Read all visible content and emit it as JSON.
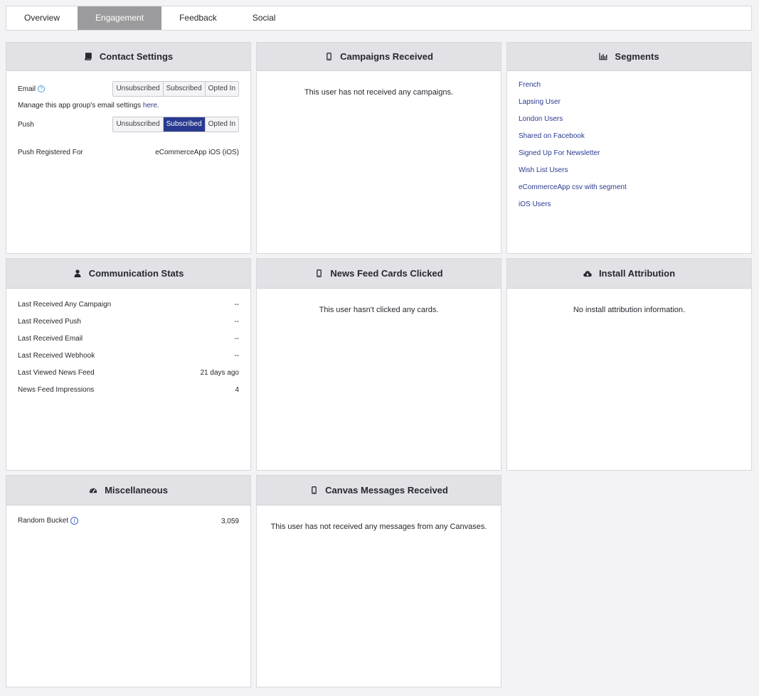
{
  "tabs": [
    {
      "label": "Overview"
    },
    {
      "label": "Engagement"
    },
    {
      "label": "Feedback"
    },
    {
      "label": "Social"
    }
  ],
  "contact": {
    "title": "Contact Settings",
    "email_label": "Email",
    "help_glyph": "?",
    "options": [
      "Unsubscribed",
      "Subscribed",
      "Opted In"
    ],
    "manage_text": "Manage this app group's email settings ",
    "manage_link": "here",
    "manage_end": ".",
    "push_label": "Push",
    "push_registered_label": "Push Registered For",
    "push_registered_value": "eCommerceApp iOS (iOS)"
  },
  "campaigns": {
    "title": "Campaigns Received",
    "empty": "This user has not received any campaigns."
  },
  "segments": {
    "title": "Segments",
    "items": [
      "French",
      "Lapsing User",
      "London Users",
      "Shared on Facebook",
      "Signed Up For Newsletter",
      "Wish List Users",
      "eCommerceApp csv with segment",
      "iOS Users"
    ]
  },
  "comm": {
    "title": "Communication Stats",
    "rows": [
      {
        "label": "Last Received Any Campaign",
        "value": "--"
      },
      {
        "label": "Last Received Push",
        "value": "--"
      },
      {
        "label": "Last Received Email",
        "value": "--"
      },
      {
        "label": "Last Received Webhook",
        "value": "--"
      },
      {
        "label": "Last Viewed News Feed",
        "value": "21 days ago"
      },
      {
        "label": "News Feed Impressions",
        "value": "4"
      }
    ]
  },
  "newsfeed": {
    "title": "News Feed Cards Clicked",
    "empty": "This user hasn't clicked any cards."
  },
  "install": {
    "title": "Install Attribution",
    "empty": "No install attribution information."
  },
  "misc": {
    "title": "Miscellaneous",
    "random_label": "Random Bucket",
    "info_glyph": "i",
    "random_value": "3,059"
  },
  "canvas": {
    "title": "Canvas Messages Received",
    "empty": "This user has not received any messages from any Canvases."
  },
  "icons": {
    "contact": "book-icon",
    "campaigns": "mobile-phone-icon",
    "segments": "bar-chart-icon",
    "comm": "user-icon",
    "newsfeed": "mobile-phone-icon",
    "install": "cloud-download-icon",
    "misc": "dashboard-icon",
    "canvas": "mobile-phone-icon"
  },
  "colors": {
    "accent": "#283a8f",
    "link": "#2b3a8f",
    "active_tab": "#9b9b9d",
    "header_bg": "#e1e1e6",
    "page_bg": "#f3f3f5"
  }
}
